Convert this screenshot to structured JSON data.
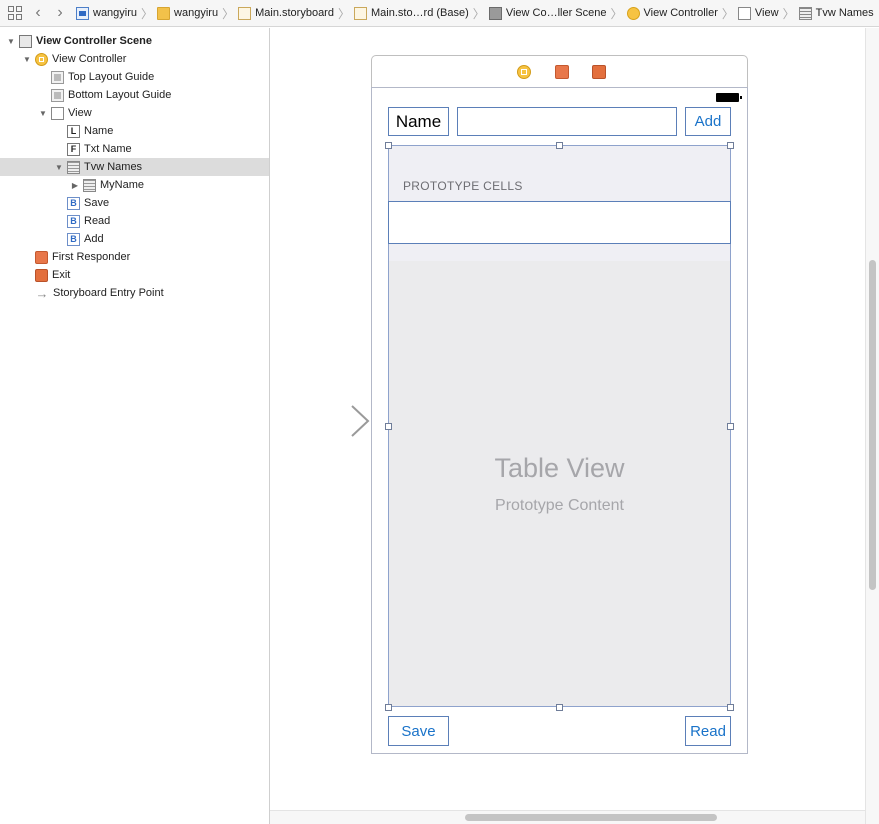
{
  "breadcrumb": {
    "items": [
      {
        "label": "wangyiru",
        "icon": "swift-project-icon"
      },
      {
        "label": "wangyiru",
        "icon": "folder-icon"
      },
      {
        "label": "Main.storyboard",
        "icon": "storyboard-file-icon"
      },
      {
        "label": "Main.sto…rd (Base)",
        "icon": "storyboard-file-icon"
      },
      {
        "label": "View Co…ller Scene",
        "icon": "scene-icon"
      },
      {
        "label": "View Controller",
        "icon": "view-controller-icon"
      },
      {
        "label": "View",
        "icon": "view-icon"
      },
      {
        "label": "Tvw Names",
        "icon": "table-view-icon"
      }
    ]
  },
  "outline": {
    "rows": [
      {
        "label": "View Controller Scene",
        "indent": 0,
        "disclosure": "open",
        "icon": "scene",
        "bold": true
      },
      {
        "label": "View Controller",
        "indent": 1,
        "disclosure": "open",
        "icon": "vc"
      },
      {
        "label": "Top Layout Guide",
        "indent": 2,
        "disclosure": "",
        "icon": "guide"
      },
      {
        "label": "Bottom Layout Guide",
        "indent": 2,
        "disclosure": "",
        "icon": "guide"
      },
      {
        "label": "View",
        "indent": 2,
        "disclosure": "open",
        "icon": "view"
      },
      {
        "label": "Name",
        "indent": 3,
        "disclosure": "",
        "icon": "label",
        "glyph": "L"
      },
      {
        "label": "Txt Name",
        "indent": 3,
        "disclosure": "",
        "icon": "field",
        "glyph": "F"
      },
      {
        "label": "Tvw Names",
        "indent": 3,
        "disclosure": "open",
        "icon": "table",
        "selected": true
      },
      {
        "label": "MyName",
        "indent": 4,
        "disclosure": "closed",
        "icon": "table"
      },
      {
        "label": "Save",
        "indent": 3,
        "disclosure": "",
        "icon": "btn",
        "glyph": "B"
      },
      {
        "label": "Read",
        "indent": 3,
        "disclosure": "",
        "icon": "btn",
        "glyph": "B"
      },
      {
        "label": "Add",
        "indent": 3,
        "disclosure": "",
        "icon": "btn",
        "glyph": "B"
      },
      {
        "label": "First Responder",
        "indent": 1,
        "disclosure": "",
        "icon": "resp"
      },
      {
        "label": "Exit",
        "indent": 1,
        "disclosure": "",
        "icon": "exit"
      },
      {
        "label": "Storyboard Entry Point",
        "indent": 1,
        "disclosure": "",
        "icon": "arrow"
      }
    ]
  },
  "scene": {
    "name_label": "Name",
    "name_field_value": "",
    "add_button": "Add",
    "save_button": "Save",
    "read_button": "Read",
    "prototype_cells_title": "PROTOTYPE CELLS",
    "table_view_title": "Table View",
    "table_view_subtitle": "Prototype Content"
  },
  "icons": {
    "back": "chevron-left-icon",
    "forward": "chevron-right-icon",
    "related": "grid-icon"
  }
}
